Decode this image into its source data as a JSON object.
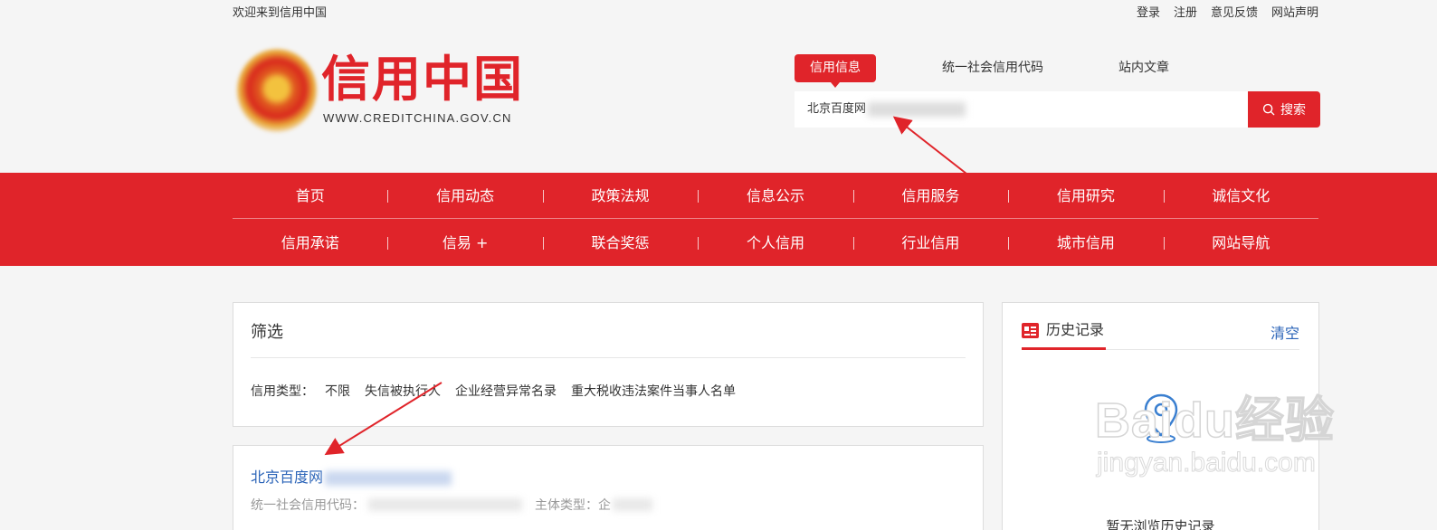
{
  "topbar": {
    "welcome": "欢迎来到信用中国",
    "links": [
      "登录",
      "注册",
      "意见反馈",
      "网站声明"
    ]
  },
  "logo": {
    "title": "信用中国",
    "subtitle": "WWW.CREDITCHINA.GOV.CN"
  },
  "search": {
    "tabs": [
      "信用信息",
      "统一社会信用代码",
      "站内文章"
    ],
    "active_tab": "信用信息",
    "query": "北京百度网",
    "button_label": "搜索"
  },
  "nav": {
    "row1": [
      "首页",
      "信用动态",
      "政策法规",
      "信息公示",
      "信用服务",
      "信用研究",
      "诚信文化"
    ],
    "row2": [
      "信用承诺",
      "信易 +",
      "联合奖惩",
      "个人信用",
      "行业信用",
      "城市信用",
      "网站导航"
    ]
  },
  "filter": {
    "title": "筛选",
    "label": "信用类型：",
    "options": [
      "不限",
      "失信被执行人",
      "企业经营异常名录",
      "重大税收违法案件当事人名单"
    ]
  },
  "result": {
    "name": "北京百度网",
    "code_label": "统一社会信用代码：",
    "type_label": "主体类型：",
    "type_value": "企"
  },
  "history": {
    "title": "历史记录",
    "clear": "清空",
    "empty": "暂无浏览历史记录"
  },
  "watermark": {
    "brand": "Baidu经验",
    "url": "jingyan.baidu.com"
  },
  "colors": {
    "primary": "#e0242a",
    "link": "#2b64b8",
    "background": "#f5f5f5"
  }
}
